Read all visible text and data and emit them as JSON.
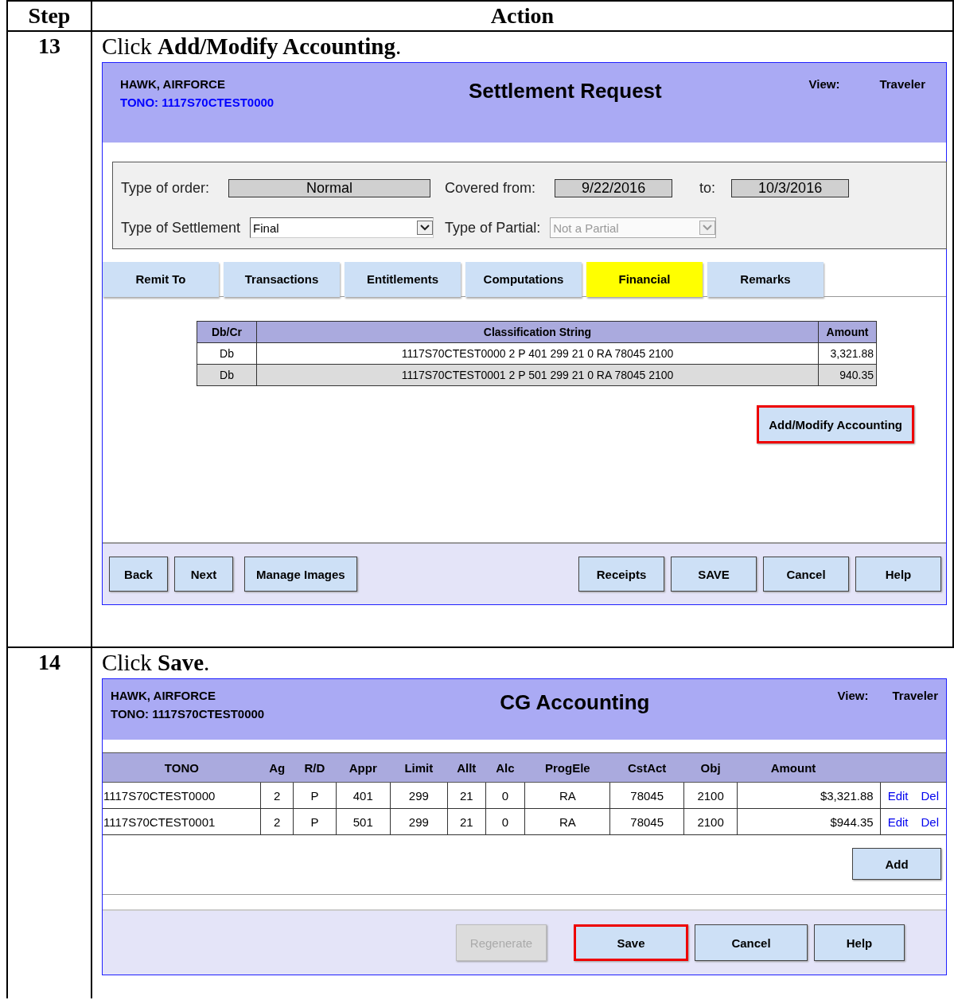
{
  "table": {
    "columns": [
      "Step",
      "Action"
    ],
    "rows": [
      {
        "step": "13",
        "instruction": "Click **Add/Modify Accounting**.",
        "screen": {
          "kind": "settlement",
          "header": {
            "name": "HAWK, AIRFORCE",
            "tono": "TONO: 1117S70CTEST0000",
            "tono_is_link": true,
            "title": "Settlement Request",
            "view_label": "View:",
            "view_value": "Traveler"
          },
          "form": {
            "type_of_order_label": "Type of order:",
            "type_of_order": "Normal",
            "covered_from_label": "Covered from:",
            "covered_from": "9/22/2016",
            "to_label": "to:",
            "to": "10/3/2016",
            "settlement_label": "Type of Settlement",
            "settlement": {
              "value": "Final",
              "disabled": false
            },
            "partial_label": "Type of Partial:",
            "partial": {
              "value": "Not a Partial",
              "disabled": true
            }
          },
          "tabs": [
            {
              "label": "Remit To",
              "selected": false
            },
            {
              "label": "Transactions",
              "selected": false
            },
            {
              "label": "Entitlements",
              "selected": false
            },
            {
              "label": "Computations",
              "selected": false
            },
            {
              "label": "Financial",
              "selected": true
            },
            {
              "label": "Remarks",
              "selected": false
            }
          ],
          "grid": {
            "columns": [
              "Db/Cr",
              "Classification String",
              "Amount"
            ],
            "rows": [
              {
                "cells": [
                  "Db",
                  "1117S70CTEST0000 2 P 401 299 21 0 RA 78045 2100",
                  "3,321.88"
                ],
                "shaded": false
              },
              {
                "cells": [
                  "Db",
                  "1117S70CTEST0001 2 P 501 299 21 0 RA 78045 2100",
                  "940.35"
                ],
                "shaded": true
              }
            ]
          },
          "action_button": {
            "label": "Add/Modify Accounting",
            "highlighted": true
          },
          "footer": {
            "left": [
              {
                "label": "Back",
                "highlighted": false,
                "disabled": false
              },
              {
                "label": "Next",
                "highlighted": false,
                "disabled": false
              },
              {
                "label": "Manage Images",
                "highlighted": false,
                "disabled": false
              }
            ],
            "right": [
              {
                "label": "Receipts",
                "highlighted": false,
                "disabled": false
              },
              {
                "label": "SAVE",
                "highlighted": false,
                "disabled": false
              },
              {
                "label": "Cancel",
                "highlighted": false,
                "disabled": false
              },
              {
                "label": "Help",
                "highlighted": false,
                "disabled": false
              }
            ]
          }
        }
      },
      {
        "step": "14",
        "instruction": "Click **Save**.",
        "screen": {
          "kind": "accounting",
          "header": {
            "name": "HAWK, AIRFORCE",
            "tono": "TONO: 1117S70CTEST0000",
            "tono_is_link": false,
            "title": "CG Accounting",
            "view_label": "View:",
            "view_value": "Traveler"
          },
          "grid": {
            "columns": [
              "TONO",
              "Ag",
              "R/D",
              "Appr",
              "Limit",
              "Allt",
              "Alc",
              "ProgEle",
              "CstAct",
              "Obj",
              "Amount"
            ],
            "rows": [
              {
                "cells": [
                  "1117S70CTEST0000",
                  "2",
                  "P",
                  "401",
                  "299",
                  "21",
                  "0",
                  "RA",
                  "78045",
                  "2100",
                  "$3,321.88"
                ],
                "links": [
                  "Edit",
                  "Del"
                ]
              },
              {
                "cells": [
                  "1117S70CTEST0001",
                  "2",
                  "P",
                  "501",
                  "299",
                  "21",
                  "0",
                  "RA",
                  "78045",
                  "2100",
                  "$944.35"
                ],
                "links": [
                  "Edit",
                  "Del"
                ]
              }
            ]
          },
          "action_button": {
            "label": "Add",
            "highlighted": false
          },
          "footer": {
            "right": [
              {
                "label": "Regenerate",
                "highlighted": false,
                "disabled": true
              },
              {
                "label": "Save",
                "highlighted": true,
                "disabled": false
              },
              {
                "label": "Cancel",
                "highlighted": false,
                "disabled": false
              },
              {
                "label": "Help",
                "highlighted": false,
                "disabled": false
              }
            ]
          }
        }
      }
    ]
  }
}
